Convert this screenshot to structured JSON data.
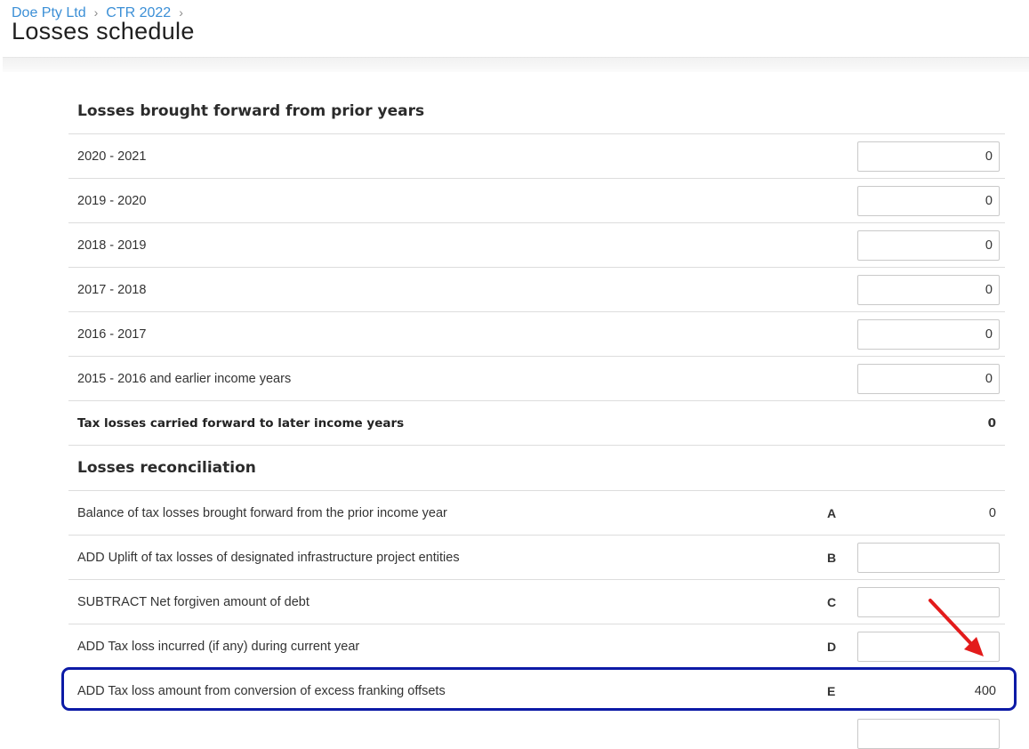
{
  "breadcrumb": {
    "items": [
      "Doe Pty Ltd",
      "CTR 2022"
    ],
    "separator": "›"
  },
  "page": {
    "title": "Losses schedule"
  },
  "brought_forward": {
    "heading": "Losses brought forward from prior years",
    "rows": [
      {
        "label": "2020 - 2021",
        "value": "0"
      },
      {
        "label": "2019 - 2020",
        "value": "0"
      },
      {
        "label": "2018 - 2019",
        "value": "0"
      },
      {
        "label": "2017 - 2018",
        "value": "0"
      },
      {
        "label": "2016 - 2017",
        "value": "0"
      },
      {
        "label": "2015 - 2016 and earlier income years",
        "value": "0"
      }
    ],
    "total": {
      "label": "Tax losses carried forward to later income years",
      "value": "0"
    }
  },
  "reconciliation": {
    "heading": "Losses reconciliation",
    "rows": [
      {
        "label": "Balance of tax losses brought forward from the prior income year",
        "code": "A",
        "value": "0"
      },
      {
        "label": "ADD Uplift of tax losses of designated infrastructure project entities",
        "code": "B",
        "value": ""
      },
      {
        "label": "SUBTRACT Net forgiven amount of debt",
        "code": "C",
        "value": ""
      },
      {
        "label": "ADD Tax loss incurred (if any) during current year",
        "code": "D",
        "value": ""
      },
      {
        "label": "ADD Tax loss amount from conversion of excess franking offsets",
        "code": "E",
        "value": "400"
      }
    ]
  },
  "annotations": {
    "highlight_color": "#0c1aa6",
    "arrow_color": "#e31b1b"
  }
}
